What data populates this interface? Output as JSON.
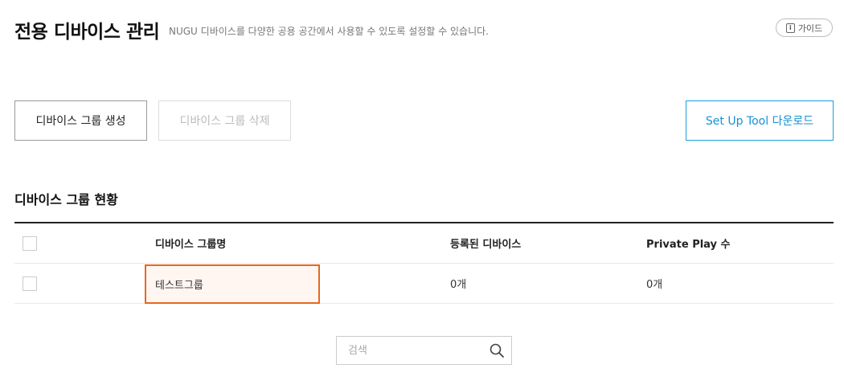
{
  "header": {
    "title": "전용 디바이스 관리",
    "subtitle": "NUGU 디바이스를 다양한 공용 공간에서 사용할 수 있도록 설정할 수 있습니다.",
    "guide_label": "가이드",
    "guide_icon_glyph": "i"
  },
  "actions": {
    "create_label": "디바이스 그룹 생성",
    "delete_label": "디바이스 그룹 삭제",
    "setup_label": "Set Up Tool 다운로드"
  },
  "section": {
    "title": "디바이스 그룹 현황"
  },
  "table": {
    "columns": {
      "name": "디바이스 그룹명",
      "devices": "등록된 디바이스",
      "private_play": "Private Play 수"
    },
    "rows": [
      {
        "name": "테스트그룹",
        "devices": "0개",
        "private_play": "0개"
      }
    ]
  },
  "search": {
    "placeholder": "검색",
    "value": ""
  },
  "colors": {
    "accent_blue": "#1592d6",
    "highlight_orange": "#e8671e"
  },
  "icons": {
    "guide": "info-icon",
    "search": "search-icon"
  }
}
